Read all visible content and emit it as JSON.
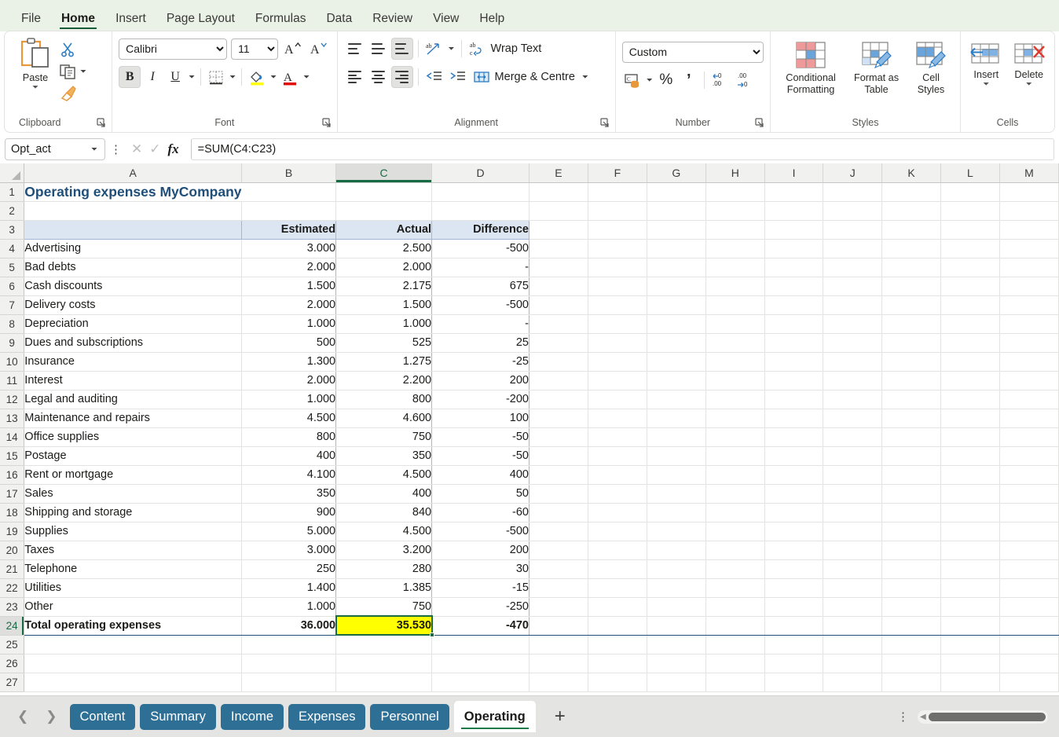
{
  "ribbon": {
    "tabs": [
      {
        "label": "File",
        "active": false
      },
      {
        "label": "Home",
        "active": true
      },
      {
        "label": "Insert",
        "active": false
      },
      {
        "label": "Page Layout",
        "active": false
      },
      {
        "label": "Formulas",
        "active": false
      },
      {
        "label": "Data",
        "active": false
      },
      {
        "label": "Review",
        "active": false
      },
      {
        "label": "View",
        "active": false
      },
      {
        "label": "Help",
        "active": false
      }
    ],
    "clipboard": {
      "group_label": "Clipboard",
      "paste_label": "Paste",
      "cut_tip": "Cut",
      "copy_tip": "Copy",
      "format_painter_tip": "Format Painter"
    },
    "font": {
      "group_label": "Font",
      "font_name": "Calibri",
      "font_size": "11",
      "grow_tip": "Increase Font Size",
      "shrink_tip": "Decrease Font Size",
      "bold": "B",
      "italic": "I",
      "underline": "U",
      "borders_tip": "Borders",
      "fill_color_tip": "Fill Color",
      "font_color_tip": "Font Color",
      "fill_color": "#ffff00",
      "font_color": "#e00000"
    },
    "alignment": {
      "group_label": "Alignment",
      "wrap_text": "Wrap Text",
      "merge_centre": "Merge & Centre",
      "orientation_tip": "Orientation",
      "decrease_indent_tip": "Decrease Indent",
      "increase_indent_tip": "Increase Indent"
    },
    "number": {
      "group_label": "Number",
      "format": "Custom",
      "accounting_tip": "Accounting Number Format",
      "percent": "%",
      "comma": "’",
      "decrease_decimal_tip": "Decrease Decimal",
      "increase_decimal_tip": "Increase Decimal"
    },
    "styles": {
      "group_label": "Styles",
      "conditional_formatting": "Conditional Formatting",
      "format_as_table": "Format as Table",
      "cell_styles": "Cell Styles"
    },
    "cells": {
      "group_label": "Cells",
      "insert": "Insert",
      "delete": "Delete"
    }
  },
  "formula_bar": {
    "name_box": "Opt_act",
    "cancel_tip": "Cancel",
    "enter_tip": "Enter",
    "fx_label": "fx",
    "formula": "=SUM(C4:C23)"
  },
  "grid": {
    "columns": [
      "A",
      "B",
      "C",
      "D",
      "E",
      "F",
      "G",
      "H",
      "I",
      "J",
      "K",
      "L",
      "M"
    ],
    "selected_column": "C",
    "selected_row": 24,
    "rows": [
      1,
      2,
      3,
      4,
      5,
      6,
      7,
      8,
      9,
      10,
      11,
      12,
      13,
      14,
      15,
      16,
      17,
      18,
      19,
      20,
      21,
      22,
      23,
      24,
      25,
      26,
      27
    ],
    "title": "Operating expenses MyCompany",
    "headers": [
      "",
      "Estimated",
      "Actual",
      "Difference"
    ],
    "data": [
      {
        "row": 4,
        "name": "Advertising",
        "estimated": "3.000",
        "actual": "2.500",
        "difference": "-500"
      },
      {
        "row": 5,
        "name": "Bad debts",
        "estimated": "2.000",
        "actual": "2.000",
        "difference": "-"
      },
      {
        "row": 6,
        "name": "Cash discounts",
        "estimated": "1.500",
        "actual": "2.175",
        "difference": "675"
      },
      {
        "row": 7,
        "name": "Delivery costs",
        "estimated": "2.000",
        "actual": "1.500",
        "difference": "-500"
      },
      {
        "row": 8,
        "name": "Depreciation",
        "estimated": "1.000",
        "actual": "1.000",
        "difference": "-"
      },
      {
        "row": 9,
        "name": "Dues and subscriptions",
        "estimated": "500",
        "actual": "525",
        "difference": "25"
      },
      {
        "row": 10,
        "name": "Insurance",
        "estimated": "1.300",
        "actual": "1.275",
        "difference": "-25"
      },
      {
        "row": 11,
        "name": "Interest",
        "estimated": "2.000",
        "actual": "2.200",
        "difference": "200"
      },
      {
        "row": 12,
        "name": "Legal and auditing",
        "estimated": "1.000",
        "actual": "800",
        "difference": "-200"
      },
      {
        "row": 13,
        "name": "Maintenance and repairs",
        "estimated": "4.500",
        "actual": "4.600",
        "difference": "100"
      },
      {
        "row": 14,
        "name": "Office supplies",
        "estimated": "800",
        "actual": "750",
        "difference": "-50"
      },
      {
        "row": 15,
        "name": "Postage",
        "estimated": "400",
        "actual": "350",
        "difference": "-50"
      },
      {
        "row": 16,
        "name": "Rent or mortgage",
        "estimated": "4.100",
        "actual": "4.500",
        "difference": "400"
      },
      {
        "row": 17,
        "name": "Sales",
        "estimated": "350",
        "actual": "400",
        "difference": "50"
      },
      {
        "row": 18,
        "name": "Shipping and storage",
        "estimated": "900",
        "actual": "840",
        "difference": "-60"
      },
      {
        "row": 19,
        "name": "Supplies",
        "estimated": "5.000",
        "actual": "4.500",
        "difference": "-500"
      },
      {
        "row": 20,
        "name": "Taxes",
        "estimated": "3.000",
        "actual": "3.200",
        "difference": "200"
      },
      {
        "row": 21,
        "name": "Telephone",
        "estimated": "250",
        "actual": "280",
        "difference": "30"
      },
      {
        "row": 22,
        "name": "Utilities",
        "estimated": "1.400",
        "actual": "1.385",
        "difference": "-15"
      },
      {
        "row": 23,
        "name": "Other",
        "estimated": "1.000",
        "actual": "750",
        "difference": "-250"
      }
    ],
    "total": {
      "row": 24,
      "name": "Total operating expenses",
      "estimated": "36.000",
      "actual": "35.530",
      "difference": "-470"
    },
    "highlight_color": "#ffff00",
    "title_color": "#1f4e79",
    "header_fill": "#dce6f2",
    "selection_color": "#1a6b40"
  },
  "sheet_bar": {
    "prev_tip": "Previous Sheet",
    "next_tip": "Next Sheet",
    "tabs": [
      {
        "label": "Content",
        "active": false
      },
      {
        "label": "Summary",
        "active": false
      },
      {
        "label": "Income",
        "active": false
      },
      {
        "label": "Expenses",
        "active": false
      },
      {
        "label": "Personnel",
        "active": false
      },
      {
        "label": "Operating",
        "active": true
      }
    ],
    "add_sheet": "+",
    "more_tip": "More options",
    "tab_color": "#2e6f96"
  }
}
